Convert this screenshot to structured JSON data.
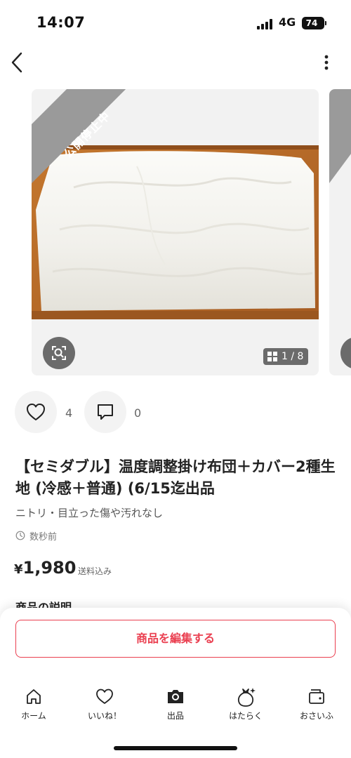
{
  "status_bar": {
    "time": "14:07",
    "network": "4G",
    "battery": "74"
  },
  "header": {
    "back_icon": "chevron-left-icon",
    "more_icon": "more-vertical-icon"
  },
  "gallery": {
    "ribbon_label": "公開停止中",
    "page_indicator": "1 / 8",
    "lens_icon": "image-search-icon",
    "grid_icon": "grid-icon"
  },
  "actions": {
    "like_count": "4",
    "comment_count": "0"
  },
  "product": {
    "title": "【セミダブル】温度調整掛け布団＋カバー2種生地 (冷感＋普通) (6/15迄出品",
    "subtitle": "ニトリ・目立った傷や汚れなし",
    "posted": "数秒前",
    "price": "1,980",
    "currency": "¥",
    "shipping": "送料込み",
    "description_heading": "商品の説明"
  },
  "edit_button": {
    "label": "商品を編集する"
  },
  "tab_bar": {
    "items": [
      {
        "label": "ホーム",
        "icon": "home-icon"
      },
      {
        "label": "いいね！",
        "icon": "heart-icon"
      },
      {
        "label": "出品",
        "icon": "camera-icon"
      },
      {
        "label": "はたらく",
        "icon": "money-bag-icon"
      },
      {
        "label": "おさいふ",
        "icon": "wallet-icon"
      }
    ]
  },
  "colors": {
    "accent": "#ea3f50",
    "ribbon": "#9a9a9a",
    "button_gray": "#6b6b6b"
  }
}
